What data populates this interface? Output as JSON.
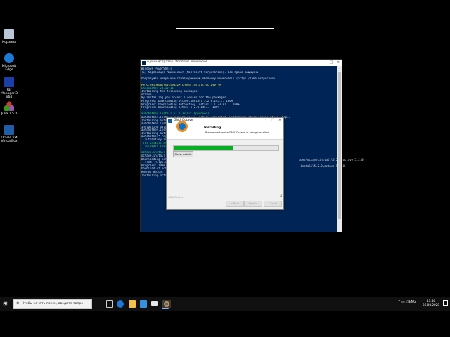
{
  "desktop": {
    "icons": [
      {
        "label": "Корзина",
        "icon": "recycle-bin-icon",
        "color": "#b9c7d8"
      },
      {
        "label": "Microsoft Edge",
        "icon": "edge-icon",
        "color": "#1e78d6"
      },
      {
        "label": "Far Manager 3 x64",
        "icon": "far-manager-icon",
        "color": "#1a3fa8"
      },
      {
        "label": "Julia 1.5.0",
        "icon": "julia-icon",
        "color": "#9558b2"
      },
      {
        "label": "Oracle VM VirtualBox",
        "icon": "virtualbox-icon",
        "color": "#1f5ea8"
      }
    ]
  },
  "powershell": {
    "title": "Администратор: Windows PowerShell",
    "lines": [
      {
        "text": "Windows PowerShell",
        "color": "#d8d8d8"
      },
      {
        "text": "(C) Корпорация Майкрософт (Microsoft Corporation). Все права защищены.",
        "color": "#d8d8d8"
      },
      {
        "text": "",
        "color": "#d8d8d8"
      },
      {
        "text": "Попробуйте новую кроссплатформенную оболочку PowerShell (https://aka.ms/pscore6)",
        "color": "#d8d8d8"
      },
      {
        "text": "",
        "color": "#d8d8d8"
      },
      {
        "text": "PS C:\\Windows\\system32> choco install octave -y",
        "color": "#f5f543"
      },
      {
        "text": "Chocolatey v0.10.15",
        "color": "#3fd74f"
      },
      {
        "text": "Installing the following packages:",
        "color": "#d8d8d8"
      },
      {
        "text": "octave",
        "color": "#d8d8d8"
      },
      {
        "text": "By installing you accept licenses for the packages.",
        "color": "#d8d8d8"
      },
      {
        "text": "Progress: Downloading octave.install 5.2.0.145... 100%",
        "color": "#d8d8d8"
      },
      {
        "text": "Progress: Downloading autohotkey.install 1.1.33.02... 100%",
        "color": "#d8d8d8"
      },
      {
        "text": "Progress: Downloading octave 5.2.0.145... 100%",
        "color": "#d8d8d8"
      },
      {
        "text": "",
        "color": "#d8d8d8"
      },
      {
        "text": "autohotkey.install v1.1.33.02 [Approved]",
        "color": "#3fd74f"
      },
      {
        "text": "autohotkey.install package files install completed. Performing other installation steps.",
        "color": "#d8d8d8"
      },
      {
        "text": "Installing auto",
        "color": "#d8d8d8"
      },
      {
        "text": "autohotkey.inst",
        "color": "#d8d8d8"
      },
      {
        "text": "Installing auto",
        "color": "#d8d8d8"
      },
      {
        "text": "autohotkey.inst",
        "color": "#d8d8d8"
      },
      {
        "text": "Installing auto",
        "color": "#d8d8d8"
      },
      {
        "text": "autohotkey* regi",
        "color": "#d8d8d8"
      },
      {
        "text": "  autohotkey.in",
        "color": "#d8d8d8"
      },
      {
        "text": " The install of",
        "color": "#3fd74f"
      },
      {
        "text": "  Software insta",
        "color": "#3fd74f"
      },
      {
        "text": "",
        "color": "#d8d8d8"
      },
      {
        "text": "octave.install v",
        "color": "#3fd74f"
      },
      {
        "text": "octave.install p",
        "color": "#d8d8d8"
      },
      {
        "text": "Downloading octa",
        "color": "#d8d8d8"
      },
      {
        "text": "  from 'https:/",
        "color": "#d8d8d8"
      },
      {
        "text": "Progress: 100%",
        "color": "#d8d8d8"
      },
      {
        "text": "Download of octa",
        "color": "#d8d8d8"
      },
      {
        "text": "Hashes match.",
        "color": "#d8d8d8"
      },
      {
        "text": "Installing octav",
        "color": "#d8d8d8"
      }
    ],
    "right_fragments": [
      "ages\\octave.install\\5.2.0\\octave-5.2.0-",
      ".install\\5.2.0\\octave-5.2.0"
    ]
  },
  "dialog": {
    "title": "GNU Octave",
    "heading": "Installing",
    "subheading": "Please wait while GNU Octave is being installed.",
    "progress": 0.57,
    "show_details": "Show details",
    "brand": "GNU Octave",
    "back": "< Back",
    "next": "Next >",
    "cancel": "Cancel"
  },
  "taskbar": {
    "search_placeholder": "Чтобы начать поиск, введите запро",
    "apps": [
      {
        "icon": "task-view-icon",
        "color": "#cfcfcf"
      },
      {
        "icon": "edge-taskbar-icon",
        "color": "#1e78d6"
      },
      {
        "icon": "explorer-icon",
        "color": "#f1c14a"
      },
      {
        "icon": "store-icon",
        "color": "#3a8fe0"
      },
      {
        "icon": "mail-icon",
        "color": "#e8e8e8"
      },
      {
        "icon": "powershell-taskbar-icon",
        "color": "#2a6fc9"
      },
      {
        "icon": "octave-taskbar-icon",
        "color": "#e08a2b"
      }
    ],
    "language": "ENG",
    "time": "11:46",
    "date": "26.08.2020"
  }
}
